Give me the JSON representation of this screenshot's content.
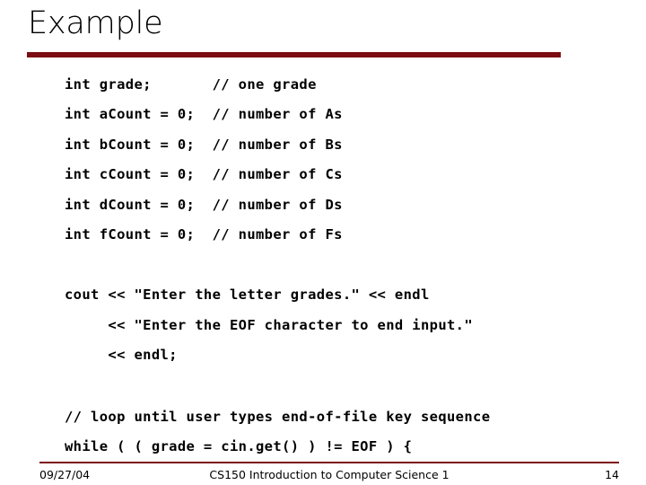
{
  "slide": {
    "title": "Example",
    "accent_color": "#7B0D12",
    "background_color": "#FFFFFF",
    "text_color": "#000000"
  },
  "code": {
    "lines": [
      {
        "text": "int grade;       // one grade"
      },
      {
        "text": "int aCount = 0;  // number of As"
      },
      {
        "text": "int bCount = 0;  // number of Bs"
      },
      {
        "text": "int cCount = 0;  // number of Cs"
      },
      {
        "text": "int dCount = 0;  // number of Ds"
      },
      {
        "text": "int fCount = 0;  // number of Fs"
      },
      {
        "text": "cout << \"Enter the letter grades.\" << endl"
      },
      {
        "text": "     << \"Enter the EOF character to end input.\""
      },
      {
        "text": "     << endl;"
      },
      {
        "text": "// loop until user types end-of-file key sequence"
      },
      {
        "text": "while ( ( grade = cin.get() ) != EOF ) {"
      }
    ]
  },
  "footer": {
    "date": "09/27/04",
    "course": "CS150 Introduction to Computer Science 1",
    "page_number": "14"
  }
}
